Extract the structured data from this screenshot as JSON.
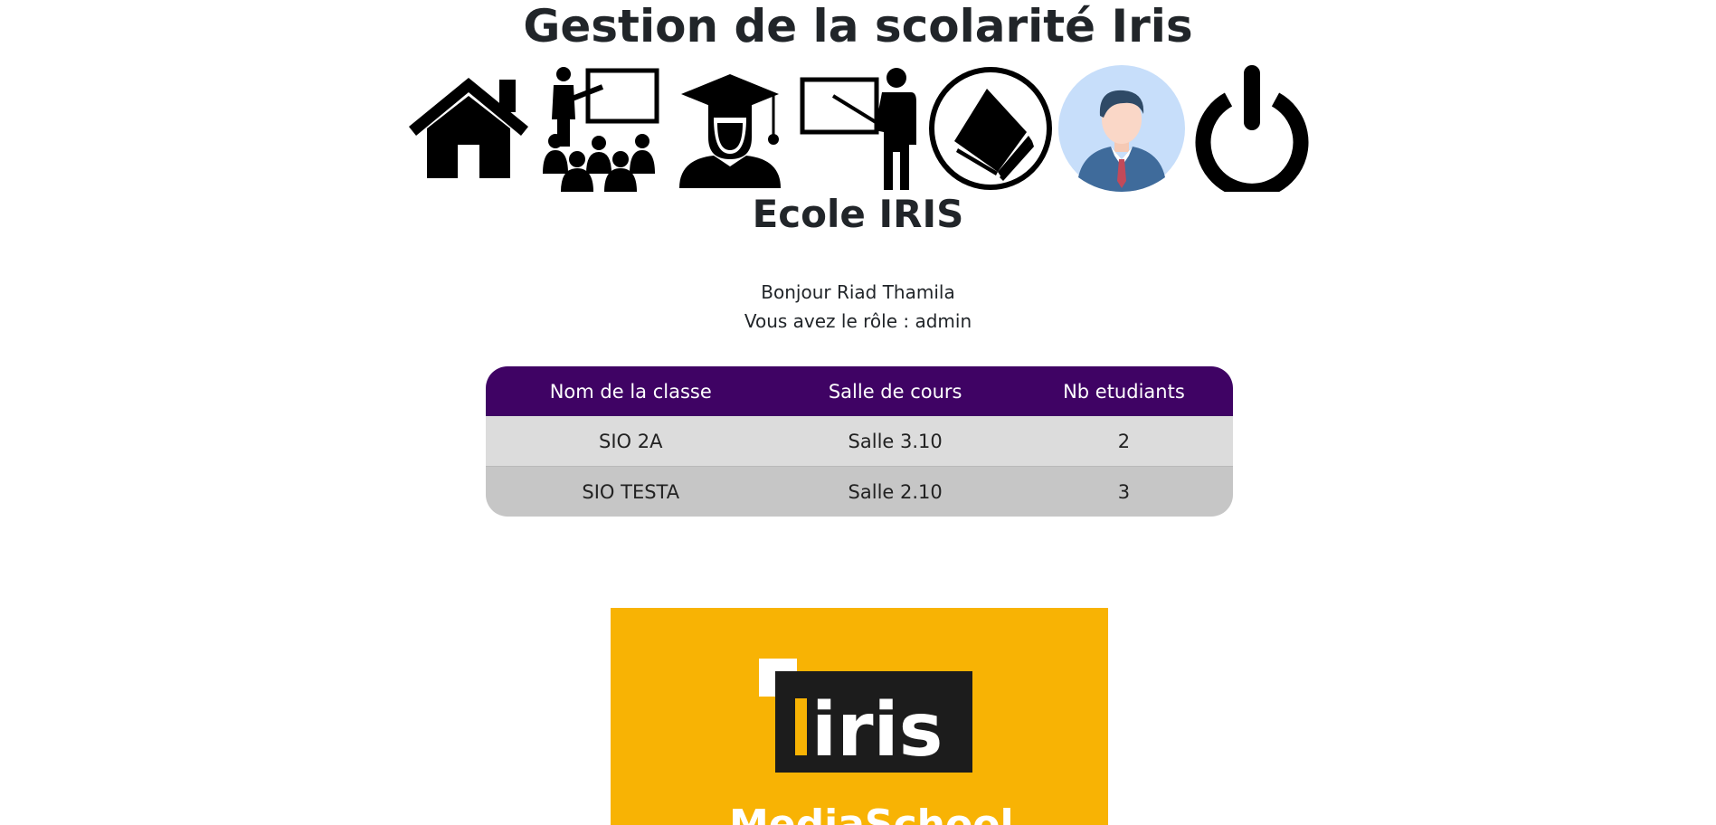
{
  "header": {
    "title": "Gestion de la scolarité Iris"
  },
  "nav": {
    "icons": [
      {
        "name": "home-icon"
      },
      {
        "name": "classroom-teacher-students-icon"
      },
      {
        "name": "student-graduate-icon"
      },
      {
        "name": "teacher-board-icon"
      },
      {
        "name": "book-icon"
      },
      {
        "name": "user-avatar-icon"
      },
      {
        "name": "power-logout-icon"
      }
    ]
  },
  "school": {
    "name": "Ecole IRIS"
  },
  "user": {
    "greeting": "Bonjour Riad Thamila",
    "role_line": "Vous avez le rôle : admin"
  },
  "classes_table": {
    "headers": [
      "Nom de la classe",
      "Salle de cours",
      "Nb etudiants"
    ],
    "rows": [
      [
        "SIO 2A",
        "Salle 3.10",
        "2"
      ],
      [
        "SIO TESTA",
        "Salle 2.10",
        "3"
      ]
    ]
  },
  "logo": {
    "text": "iris",
    "subtext": "MediaSchool",
    "background": "#f8b304"
  },
  "colors": {
    "table_header": "#3f0364",
    "row_light": "#dcdcdc",
    "row_dark": "#c6c6c6",
    "logo_bg": "#f8b304"
  }
}
